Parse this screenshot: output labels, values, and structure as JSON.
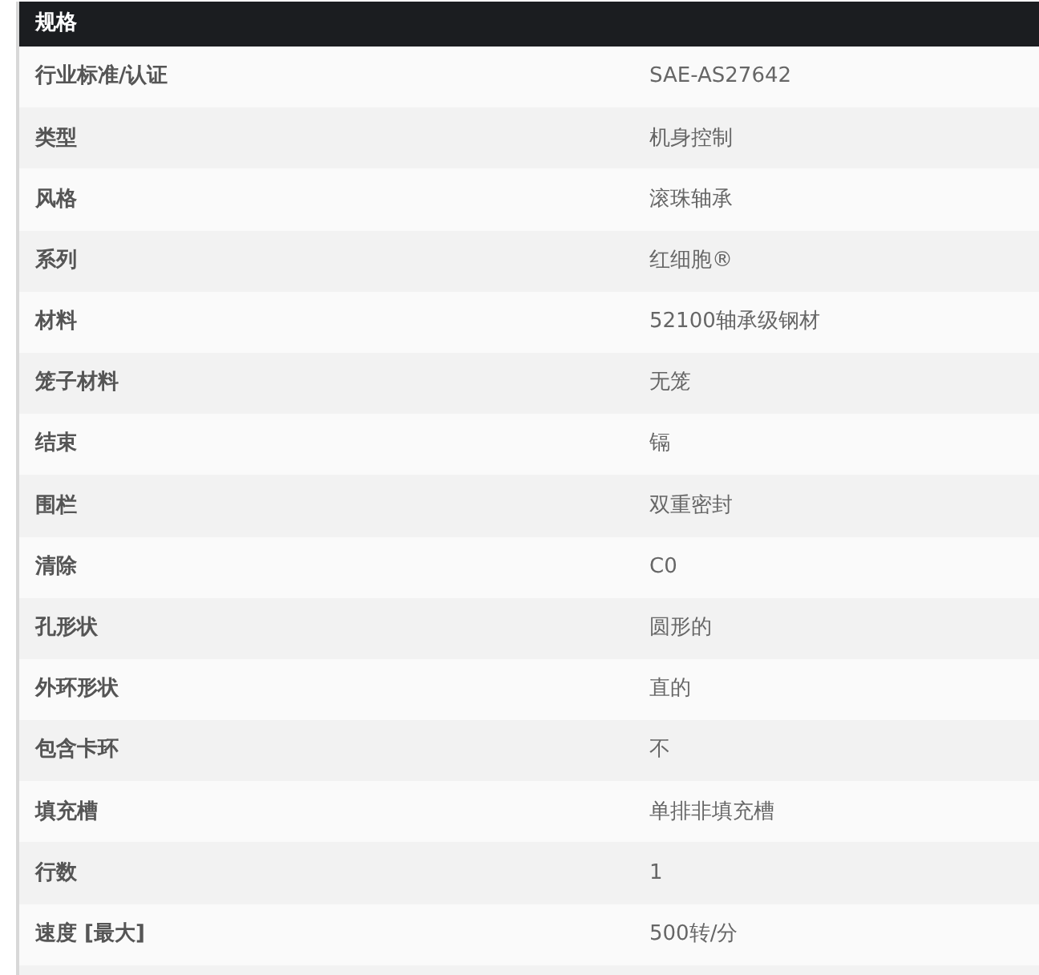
{
  "table": {
    "title": "规格",
    "rows": [
      {
        "label": "行业标准/认证",
        "value": "SAE-AS27642"
      },
      {
        "label": "类型",
        "value": "机身控制"
      },
      {
        "label": "风格",
        "value": "滚珠轴承"
      },
      {
        "label": "系列",
        "value": "红细胞®"
      },
      {
        "label": "材料",
        "value": "52100轴承级钢材"
      },
      {
        "label": "笼子材料",
        "value": "无笼"
      },
      {
        "label": "结束",
        "value": "镉"
      },
      {
        "label": "围栏",
        "value": "双重密封"
      },
      {
        "label": "清除",
        "value": "C0"
      },
      {
        "label": "孔形状",
        "value": "圆形的"
      },
      {
        "label": "外环形状",
        "value": "直的"
      },
      {
        "label": "包含卡环",
        "value": "不"
      },
      {
        "label": "填充槽",
        "value": "单排非填充槽"
      },
      {
        "label": "行数",
        "value": "1"
      },
      {
        "label": "速度 [最大]",
        "value": "500转/分"
      }
    ]
  }
}
